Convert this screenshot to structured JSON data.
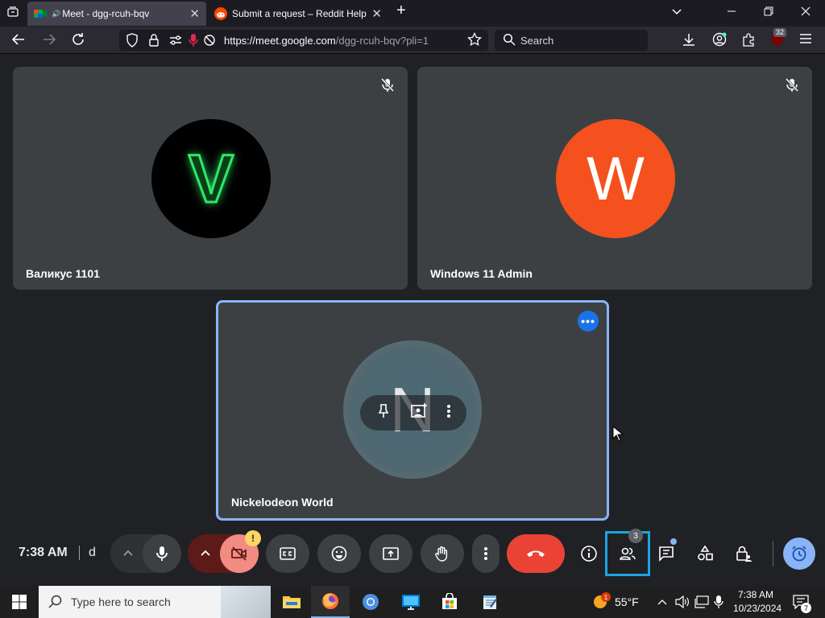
{
  "browser": {
    "tabs": [
      {
        "title": "Meet - dgg-rcuh-bqv",
        "close": "✕"
      },
      {
        "title": "Submit a request – Reddit Help",
        "close": "✕"
      }
    ],
    "new_tab": "+",
    "url_host": "https://meet.google.com",
    "url_rest": "/dgg-rcuh-bqv?pli=1",
    "search_placeholder": "Search",
    "extension_badge": "32"
  },
  "meet": {
    "participants": [
      {
        "name": "Валикус 1101",
        "initial": "V",
        "avatar_color": "#000000",
        "initial_color": "#2ee86b"
      },
      {
        "name": "Windows 11 Admin",
        "initial": "W",
        "avatar_color": "#f4511e",
        "initial_color": "#ffffff"
      },
      {
        "name": "Nickelodeon World",
        "initial": "N",
        "avatar_color": "#4a6a76",
        "initial_color": "#ffffff"
      }
    ],
    "more_options": "•••",
    "time": "7:38 AM",
    "meeting_code_visible": "d",
    "people_count": "3",
    "camera_warning": "!"
  },
  "taskbar": {
    "search_placeholder": "Type here to search",
    "weather": "55°F",
    "weather_badge": "1",
    "time": "7:38 AM",
    "date": "10/23/2024",
    "notification_count": "7"
  }
}
